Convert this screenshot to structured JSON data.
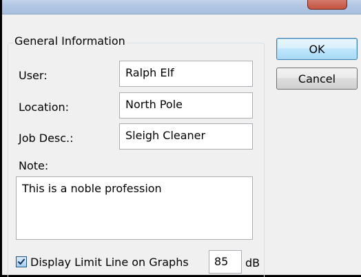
{
  "dialog": {
    "group_title": "General Information",
    "fields": {
      "user": {
        "label": "User:",
        "value": "Ralph Elf"
      },
      "location": {
        "label": "Location:",
        "value": "North Pole"
      },
      "job_desc": {
        "label": "Job Desc.:",
        "value": "Sleigh Cleaner"
      }
    },
    "note": {
      "label": "Note:",
      "value": "This is a noble profession"
    },
    "limit_line": {
      "checked": true,
      "label": "Display Limit Line on Graphs",
      "value": "85",
      "unit": "dB"
    }
  },
  "buttons": {
    "ok_label": "OK",
    "cancel_label": "Cancel"
  },
  "icons": {
    "checkmark": "check-icon"
  },
  "colors": {
    "titlebar": "#b1c6e3",
    "close_button": "#c4533f",
    "default_button_border": "#3c7fb1",
    "checkbox_fill": "#a6cdf2"
  }
}
